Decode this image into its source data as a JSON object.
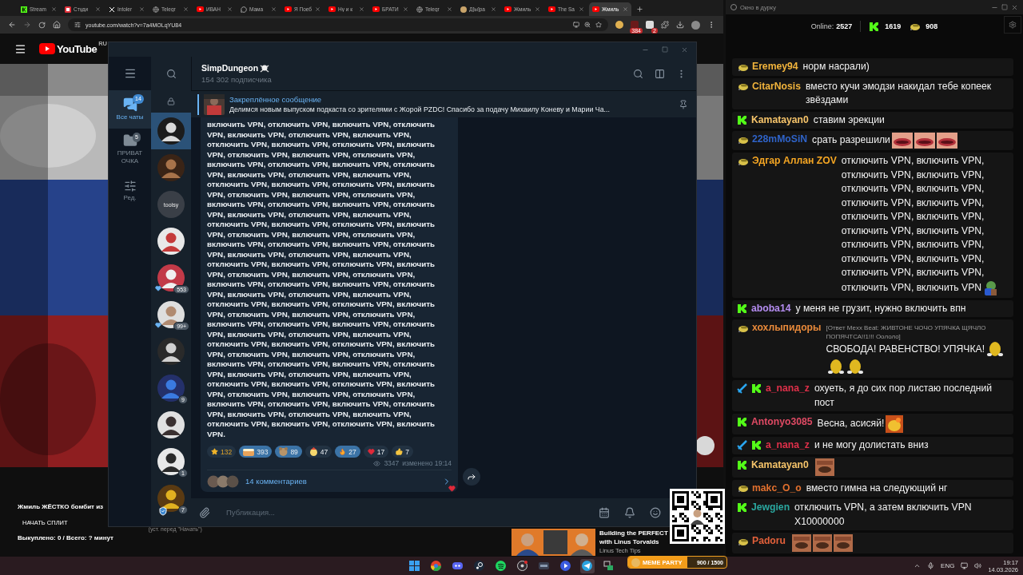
{
  "browser": {
    "tabs": [
      {
        "label": "Stream",
        "kind": "kick",
        "selected": false
      },
      {
        "label": "Студи",
        "kind": "studio",
        "selected": false
      },
      {
        "label": "Intoler",
        "kind": "x",
        "selected": false
      },
      {
        "label": "Telegr",
        "kind": "globe",
        "selected": false
      },
      {
        "label": "ИВАН",
        "kind": "youtube",
        "selected": false
      },
      {
        "label": "Мама",
        "kind": "chat",
        "selected": false
      },
      {
        "label": "Я Поеб",
        "kind": "youtube",
        "selected": false
      },
      {
        "label": "Ну и к",
        "kind": "youtube",
        "selected": false
      },
      {
        "label": "БРАТИ",
        "kind": "youtube",
        "selected": false
      },
      {
        "label": "Telegr",
        "kind": "globe",
        "selected": false
      },
      {
        "label": "Д[ы]ра",
        "kind": "face",
        "selected": false
      },
      {
        "label": "Жмиль",
        "kind": "youtube",
        "selected": false
      },
      {
        "label": "The Sa",
        "kind": "youtube",
        "selected": false
      },
      {
        "label": "Жмиль",
        "kind": "youtube",
        "selected": true
      }
    ],
    "address": "youtube.com/watch?v=7a4MOLqYU84",
    "extension_badges": [
      "384",
      "2"
    ]
  },
  "youtube": {
    "logo": "YouTube",
    "region": "RU",
    "stream_title": "Жмиль ЖЁСТКО бомбит из",
    "split_button": "НАЧАТЬ СПЛИТ",
    "split_hint": "(уст. перед \"Начать\")",
    "purchased": "Выкуплено: 0 / Всего: ? минут",
    "recommended": {
      "title": "Building the PERFECT with Linus Torvalds",
      "channel": "Linus Tech Tips"
    }
  },
  "telegram": {
    "folders": [
      {
        "kind": "chats",
        "label": "Все чаты",
        "badge": "14",
        "selected": true
      },
      {
        "kind": "folder",
        "label": "ПРИВАТ ОЧКА",
        "badge": "5",
        "selected": false
      },
      {
        "kind": "edit",
        "label": "Ред.",
        "selected": false
      }
    ],
    "chats": [
      {
        "selected": true,
        "reaction": false,
        "shield": false
      },
      {
        "selected": false,
        "reaction": false,
        "shield": false
      },
      {
        "selected": false,
        "logo": "toolsy",
        "reaction": false,
        "shield": false
      },
      {
        "selected": false,
        "reaction": false,
        "shield": false
      },
      {
        "selected": false,
        "badge": "553",
        "reaction": true,
        "shield": false
      },
      {
        "selected": false,
        "badge": "99+",
        "reaction": true,
        "shield": false
      },
      {
        "selected": false,
        "reaction": false,
        "shield": false
      },
      {
        "selected": false,
        "badge": "9",
        "reaction": false,
        "shield": false
      },
      {
        "selected": false,
        "reaction": false,
        "shield": false
      },
      {
        "selected": false,
        "badge": "1",
        "reaction": false,
        "shield": false
      },
      {
        "selected": false,
        "badge": "7",
        "reaction": false,
        "shield": true
      }
    ],
    "channel": {
      "name": "SimpDungeon",
      "subscribers": "154 302 подписчика"
    },
    "pinned": {
      "title": "Закреплённое сообщение",
      "text": "Делимся новым выпуском подкаста со зрителями с Жорой PZDC!   Спасибо за подачу Михаилу Коневу и Марии Ча..."
    },
    "post": {
      "text": "включить VPN, отключить VPN, включить VPN, отключить VPN, включить VPN, отключить VPN, включить VPN, отключить VPN, включить VPN, отключить VPN, включить VPN, отключить VPN, включить VPN, отключить VPN, включить VPN, отключить VPN, включить VPN, отключить VPN, включить VPN, отключить VPN, включить VPN, отключить VPN, включить VPN, отключить VPN, включить VPN, отключить VPN, включить VPN, отключить VPN, включить VPN, отключить VPN, включить VPN, отключить VPN, включить VPN, отключить VPN, включить VPN, отключить VPN, включить VPN, отключить VPN, включить VPN, отключить VPN, включить VPN, отключить VPN, включить VPN, отключить VPN, включить VPN, отключить VPN, включить VPN, отключить VPN, включить VPN, отключить VPN, включить VPN, отключить VPN, включить VPN, отключить VPN, включить VPN, отключить VPN, включить VPN, отключить VPN, включить VPN, отключить VPN, включить VPN, отключить VPN, включить VPN, отключить VPN, включить VPN, отключить VPN, включить VPN, отключить VPN, включить VPN, отключить VPN, включить VPN, отключить VPN, включить VPN, отключить VPN, включить VPN, отключить VPN, включить VPN, отключить VPN, включить VPN, отключить VPN, включить VPN, отключить VPN, включить VPN, отключить VPN, включить VPN, отключить VPN, включить VPN, отключить VPN, включить VPN, отключить VPN, включить VPN, отключить VPN, включить VPN, отключить VPN, включить VPN, отключить VPN, включить VPN, отключить VPN, включить VPN, отключить VPN, включить VPN, отключить VPN, включить VPN, отключить VPN, включить VPN, отключить VPN, включить VPN, отключить VPN, включить VPN.",
      "reactions": [
        {
          "kind": "star",
          "count": "132",
          "selected": false
        },
        {
          "kind": "cake",
          "count": "393",
          "selected": true
        },
        {
          "kind": "bear",
          "count": "89",
          "selected": true
        },
        {
          "kind": "chick",
          "count": "47",
          "selected": false
        },
        {
          "kind": "fire",
          "count": "27",
          "selected": true
        },
        {
          "kind": "heart",
          "count": "17",
          "selected": false
        },
        {
          "kind": "thumbs",
          "count": "7",
          "selected": false
        }
      ],
      "views": "3347",
      "edited": "изменено 19:14",
      "comments": "14 комментариев"
    },
    "composer": {
      "placeholder": "Публикация..."
    }
  },
  "chat_panel": {
    "title": "Окно в дурку",
    "online_label": "Online:",
    "online": "2527",
    "kick_count": "1619",
    "other_count": "908",
    "messages": [
      {
        "user": "Eremey94",
        "color": "#f2b43c",
        "badges": [
          {
            "kind": "bowl"
          }
        ],
        "text": "норм насрали)"
      },
      {
        "user": "CitarNosis",
        "color": "#f2b43c",
        "badges": [
          {
            "kind": "bowl"
          }
        ],
        "text": "вместо кучи эмодзи накидал тебе копеек звёздами"
      },
      {
        "user": "Kamatayan0",
        "color": "#f6c46a",
        "badges": [
          {
            "kind": "k"
          }
        ],
        "text": "ставим эрекции"
      },
      {
        "user": "228mMoSiN",
        "color": "#2f63c8",
        "badges": [
          {
            "kind": "bowl"
          }
        ],
        "text": "срать разрешили",
        "emotes": [
          {
            "kind": "lips"
          },
          {
            "kind": "lips"
          },
          {
            "kind": "lips"
          }
        ]
      },
      {
        "user": "Эдгар Аллан ZOV",
        "color": "#f5a623",
        "badges": [
          {
            "kind": "bowl"
          }
        ],
        "text": "отключить VPN, включить VPN, отключить VPN, включить VPN, отключить VPN, включить VPN, отключить VPN, включить VPN, отключить VPN, включить VPN, отключить VPN, включить VPN, отключить VPN, включить VPN, отключить VPN, включить VPN, отключить VPN, включить VPN, отключить VPN, включить VPN",
        "emotes": [
          {
            "kind": "frog"
          }
        ]
      },
      {
        "user": "aboba14",
        "color": "#b48cf0",
        "badges": [
          {
            "kind": "k"
          }
        ],
        "text": "у меня не грузит, нужно включить впн"
      },
      {
        "user": "хохлыпидоры",
        "color": "#e8893a",
        "badges": [
          {
            "kind": "bowl"
          }
        ],
        "reply": "[Ответ Mexx Beat: ЖИВТОНЕ ЧОЧО УПЯЧКА ЩЯЧЛО  ПОПЯЧТСА!!1!!! Оололо]",
        "text": "СВОБОДА! РАВЕНСТВО! УПЯЧКА!",
        "emotes": [
          {
            "kind": "potato"
          },
          {
            "kind": "potato"
          },
          {
            "kind": "potato"
          }
        ]
      },
      {
        "user": "a_nana_z",
        "color": "#e0304a",
        "badges": [
          {
            "kind": "sword"
          },
          {
            "kind": "k"
          }
        ],
        "text": "охуеть, я до сих пор листаю последний пост"
      },
      {
        "user": "Antonyo3085",
        "color": "#e04a64",
        "badges": [
          {
            "kind": "k"
          }
        ],
        "text": "Весна, асисяй!",
        "emotes": [
          {
            "kind": "duck"
          }
        ]
      },
      {
        "user": "a_nana_z",
        "color": "#e0304a",
        "badges": [
          {
            "kind": "sword"
          },
          {
            "kind": "k"
          }
        ],
        "text": "и не могу долистать вниз"
      },
      {
        "user": "Kamatayan0",
        "color": "#f6c46a",
        "badges": [
          {
            "kind": "k"
          }
        ],
        "emotes": [
          {
            "kind": "laugh"
          }
        ]
      },
      {
        "user": "makc_O_o",
        "color": "#e2702e",
        "badges": [
          {
            "kind": "bowl"
          }
        ],
        "text": "вместо гимна на следующий нг"
      },
      {
        "user": "Jewgien",
        "color": "#2aa8a0",
        "badges": [
          {
            "kind": "k"
          }
        ],
        "text": "отключить VPN, а затем включить VPN X10000000"
      },
      {
        "user": "Padoru",
        "color": "#e2603a",
        "badges": [
          {
            "kind": "bowl"
          }
        ],
        "emotes": [
          {
            "kind": "laugh"
          },
          {
            "kind": "laugh"
          },
          {
            "kind": "laugh"
          }
        ]
      }
    ]
  },
  "taskbar": {
    "apps": [
      {
        "kind": "start",
        "selected": false
      },
      {
        "kind": "browser",
        "selected": false
      },
      {
        "kind": "discord",
        "selected": false
      },
      {
        "kind": "steam",
        "selected": false
      },
      {
        "kind": "music",
        "selected": false
      },
      {
        "kind": "capture",
        "selected": false
      },
      {
        "kind": "window",
        "selected": false
      },
      {
        "kind": "player",
        "selected": false
      },
      {
        "kind": "telegram",
        "selected": true
      },
      {
        "kind": "screens",
        "selected": false
      }
    ],
    "language": "ENG",
    "time": "19:17",
    "date": "14.03.2026"
  },
  "meme_bar": {
    "label": "MEME PARTY",
    "reading": "900 / 1500",
    "level": 0.6
  }
}
